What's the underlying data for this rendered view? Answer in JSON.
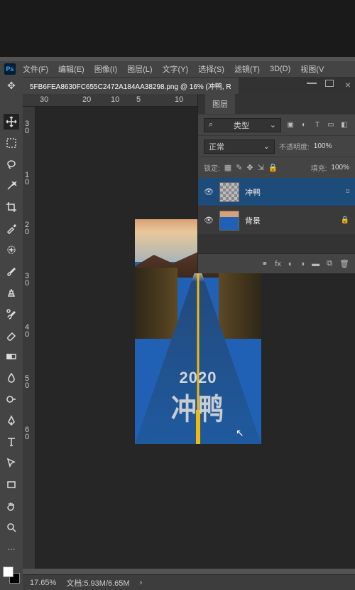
{
  "menubar": {
    "items": [
      "文件(F)",
      "编辑(E)",
      "图像(I)",
      "图层(L)",
      "文字(Y)",
      "选择(S)",
      "滤镜(T)",
      "3D(D)",
      "视图(V"
    ]
  },
  "document": {
    "tab_title": "5FB6FEA8630FC655C2472A184AA38298.png @ 16% (冲鸭, R"
  },
  "ruler_h": [
    "30",
    "20",
    "10",
    "5",
    "10"
  ],
  "ruler_v": [
    "3",
    "0",
    "1",
    "0",
    "2",
    "0",
    "3",
    "0",
    "4",
    "0",
    "5",
    "0",
    "6",
    "0"
  ],
  "artwork": {
    "year": "2020",
    "text_cn": "冲鸭"
  },
  "layers_panel": {
    "tab": "图层",
    "type_filter": "类型",
    "blend_mode": "正常",
    "opacity_label": "不透明度:",
    "opacity_value": "100%",
    "lock_label": "锁定:",
    "fill_label": "填充:",
    "fill_value": "100%",
    "layers": [
      {
        "name": "冲鸭"
      },
      {
        "name": "背景"
      }
    ]
  },
  "statusbar": {
    "zoom": "17.65%",
    "docinfo": "文档:5.93M/6.65M"
  },
  "icons": {
    "search": "⌕",
    "chevron": "⌄",
    "img": "▣",
    "circle": "◐",
    "T": "T",
    "box": "▭",
    "sq": "◧",
    "checker": "▦",
    "brush": "✎",
    "move": "✥",
    "arrows": "⇲",
    "lock": "🔒",
    "link": "⚭",
    "fx": "fx",
    "mask": "◐",
    "adj": "◑",
    "folder": "▬",
    "new": "⧉",
    "trash": "🗑",
    "chev_r": "›",
    "eye": "👁",
    "smart": "⌑"
  }
}
